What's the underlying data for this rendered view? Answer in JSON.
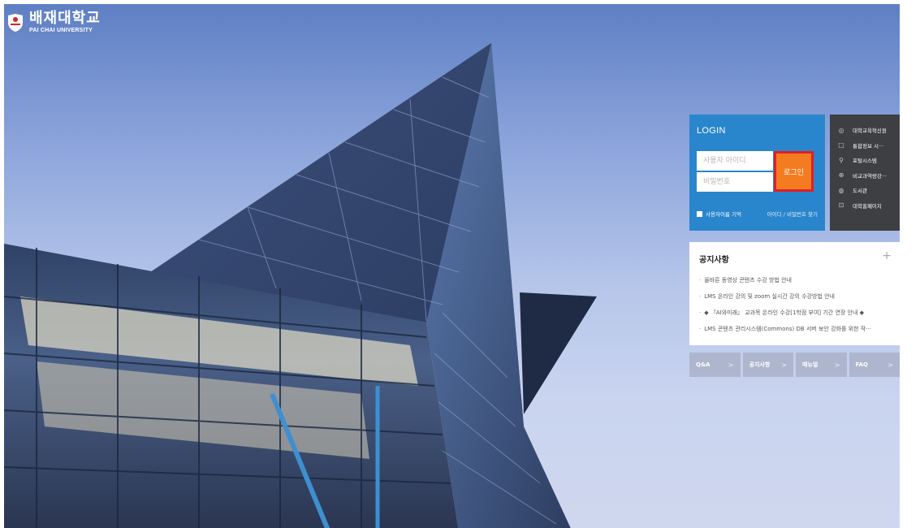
{
  "brand": {
    "name_kr": "배재대학교",
    "name_en": "PAI CHAI UNIVERSITY"
  },
  "login": {
    "title": "LOGIN",
    "id_placeholder": "사용자 아이디",
    "pw_placeholder": "비밀번호",
    "button_label": "로그인",
    "remember_label": "사용자이름 기억",
    "find_label": "아이디 / 비밀번호 찾기"
  },
  "quick_links": [
    {
      "icon": "network-icon",
      "glyph": "◎",
      "label": "대학교육혁신원"
    },
    {
      "icon": "square-icon",
      "glyph": "□",
      "label": "통합정보 시···"
    },
    {
      "icon": "link-icon",
      "glyph": "⚲",
      "label": "포털시스템"
    },
    {
      "icon": "target-icon",
      "glyph": "⊕",
      "label": "비교과역량강···"
    },
    {
      "icon": "globe-icon",
      "glyph": "◍",
      "label": "도서관"
    },
    {
      "icon": "home-icon",
      "glyph": "⊡",
      "label": "대학홈페이지"
    }
  ],
  "notice": {
    "title": "공지사항",
    "more": "+",
    "items": [
      "올바른 동영상 콘텐츠 수강 방법 안내",
      "LMS 온라인 강의 및 zoom 실시간 강의 수강방법 안내",
      "◆ 『AI와미래』 교과목 온라인 수강[1학점 부여] 기간 연장 안내 ◆",
      "LMS 콘텐츠 관리시스템(Commons) DB 서버 보안 강화를 위한 작···"
    ]
  },
  "tabs": [
    {
      "label": "Q&A",
      "arrow": ">"
    },
    {
      "label": "공지사항",
      "arrow": ">"
    },
    {
      "label": "매뉴얼",
      "arrow": ">"
    },
    {
      "label": "FAQ",
      "arrow": ">"
    }
  ],
  "colors": {
    "login_bg": "#2a86cc",
    "login_button": "#f47c20",
    "quick_bg": "#3d3f43",
    "highlight_border": "#e11f26"
  }
}
